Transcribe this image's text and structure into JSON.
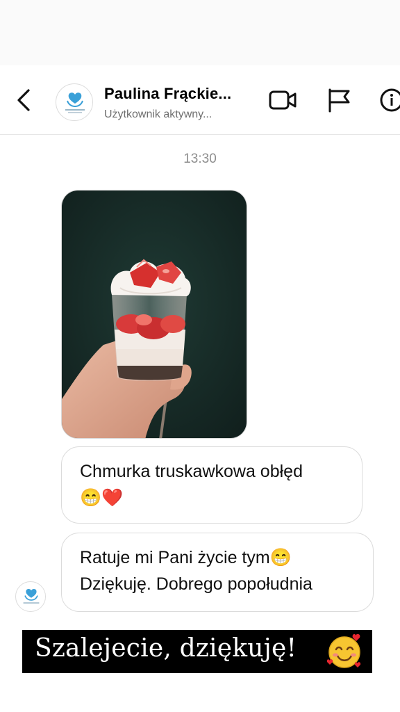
{
  "header": {
    "title": "Paulina Frąckie...",
    "subtitle": "Użytkownik aktywny...",
    "icons": [
      "back-chevron-icon",
      "video-call-icon",
      "flag-icon",
      "info-icon"
    ]
  },
  "conversation": {
    "timestamp": "13:30",
    "photo_alt": "strawberry cream dessert in glass",
    "messages": [
      {
        "line1": "Chmurka truskawkowa obłęd",
        "line2": "😁❤️"
      },
      {
        "line1": "Ratuje mi Pani życie tym😁",
        "line2": "Dziękuję. Dobrego popołudnia"
      }
    ]
  },
  "caption": {
    "text": "Szalejecie, dziękuję!",
    "emoji": "🥰"
  },
  "colors": {
    "header_bg": "#ffffff",
    "bubble_border": "#dbdbdb",
    "caption_bg": "#000000",
    "avatar_accent": "#3aa0d8"
  }
}
